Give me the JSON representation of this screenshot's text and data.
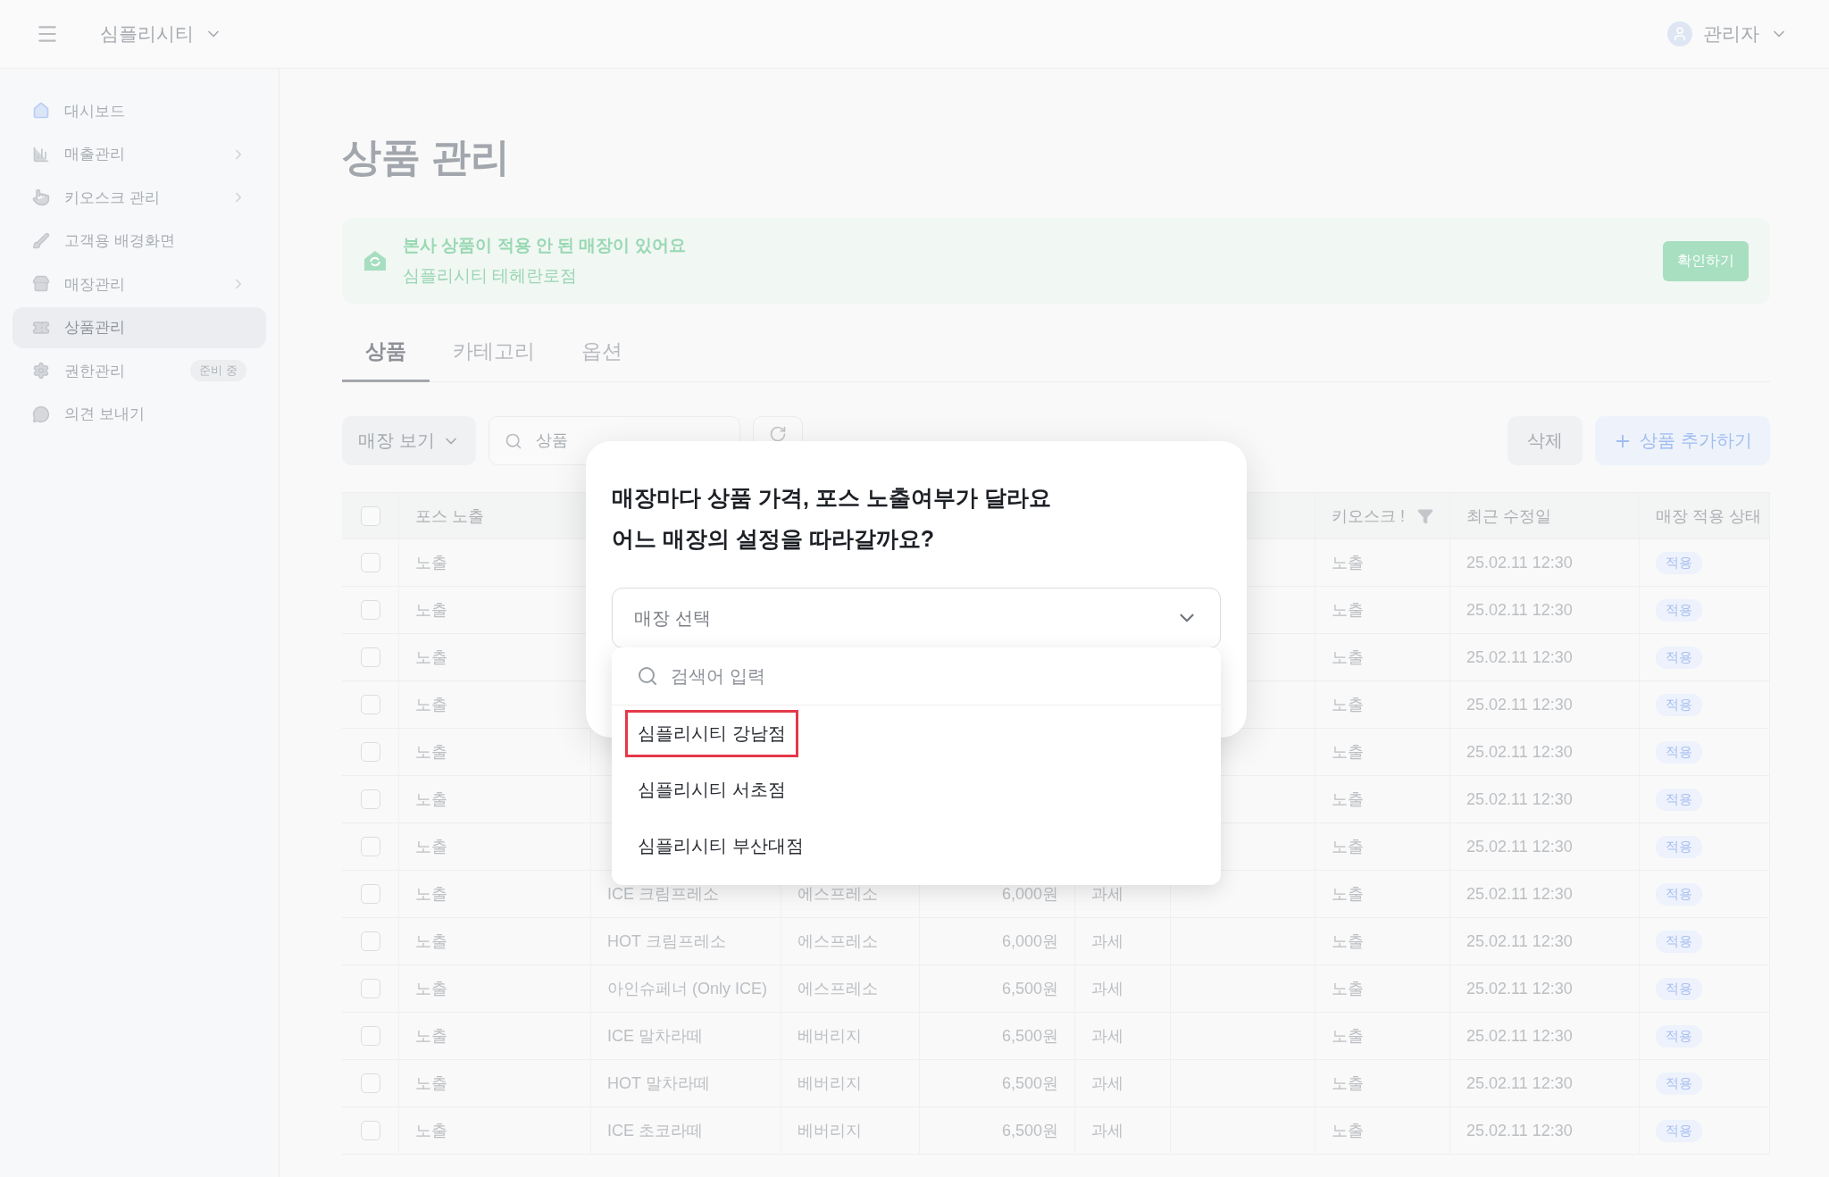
{
  "header": {
    "brand": "심플리시티",
    "user": "관리자"
  },
  "sidebar": {
    "items": [
      {
        "label": "대시보드",
        "selected": false,
        "has_submenu": false
      },
      {
        "label": "매출관리",
        "selected": false,
        "has_submenu": true
      },
      {
        "label": "키오스크 관리",
        "selected": false,
        "has_submenu": true
      },
      {
        "label": "고객용 배경화면",
        "selected": false,
        "has_submenu": false
      },
      {
        "label": "매장관리",
        "selected": false,
        "has_submenu": true
      },
      {
        "label": "상품관리",
        "selected": true,
        "has_submenu": false
      },
      {
        "label": "권한관리",
        "selected": false,
        "has_submenu": false,
        "badge": "준비 중"
      },
      {
        "label": "의견 보내기",
        "selected": false,
        "has_submenu": false
      }
    ]
  },
  "page_title": "상품 관리",
  "banner": {
    "title": "본사 상품이 적용 안 된 매장이 있어요",
    "subtitle": "심플리시티 테헤란로점",
    "button": "확인하기"
  },
  "tabs": [
    {
      "label": "상품",
      "selected": true
    },
    {
      "label": "카테고리",
      "selected": false
    },
    {
      "label": "옵션",
      "selected": false
    }
  ],
  "toolbar": {
    "store_filter": "매장 보기",
    "search_placeholder": "상품",
    "delete": "삭제",
    "add": "상품 추가하기"
  },
  "table": {
    "header": {
      "pos": "포스 노출",
      "kiosk": "키오스크 !",
      "updated": "최근 수정일",
      "status": "매장 적용 상태"
    },
    "rows": [
      {
        "checked": false,
        "pos": "노출",
        "kiosk": "노출",
        "updated": "25.02.11 12:30",
        "status": "적용"
      },
      {
        "checked": false,
        "pos": "노출",
        "kiosk": "노출",
        "updated": "25.02.11 12:30",
        "status": "적용"
      },
      {
        "checked": false,
        "pos": "노출",
        "kiosk": "노출",
        "updated": "25.02.11 12:30",
        "status": "적용"
      },
      {
        "checked": false,
        "pos": "노출",
        "kiosk": "노출",
        "updated": "25.02.11 12:30",
        "status": "적용"
      },
      {
        "checked": false,
        "pos": "노출",
        "kiosk": "노출",
        "updated": "25.02.11 12:30",
        "status": "적용"
      },
      {
        "checked": false,
        "pos": "노출",
        "kiosk": "노출",
        "updated": "25.02.11 12:30",
        "status": "적용"
      },
      {
        "checked": false,
        "pos": "노출",
        "kiosk": "노출",
        "updated": "25.02.11 12:30",
        "status": "적용"
      },
      {
        "checked": false,
        "pos": "노출",
        "name": "ICE 크림프레소",
        "category": "에스프레소",
        "price": "6,000원",
        "tax": "과세",
        "kiosk": "노출",
        "updated": "25.02.11 12:30",
        "status": "적용"
      },
      {
        "checked": false,
        "pos": "노출",
        "name": "HOT 크림프레소",
        "category": "에스프레소",
        "price": "6,000원",
        "tax": "과세",
        "kiosk": "노출",
        "updated": "25.02.11 12:30",
        "status": "적용"
      },
      {
        "checked": false,
        "pos": "노출",
        "name": "아인슈페너 (Only ICE)",
        "category": "에스프레소",
        "price": "6,500원",
        "tax": "과세",
        "kiosk": "노출",
        "updated": "25.02.11 12:30",
        "status": "적용"
      },
      {
        "checked": false,
        "pos": "노출",
        "name": "ICE 말차라떼",
        "category": "베버리지",
        "price": "6,500원",
        "tax": "과세",
        "kiosk": "노출",
        "updated": "25.02.11 12:30",
        "status": "적용"
      },
      {
        "checked": false,
        "pos": "노출",
        "name": "HOT 말차라떼",
        "category": "베버리지",
        "price": "6,500원",
        "tax": "과세",
        "kiosk": "노출",
        "updated": "25.02.11 12:30",
        "status": "적용"
      },
      {
        "checked": false,
        "pos": "노출",
        "name": "ICE 초코라떼",
        "category": "베버리지",
        "price": "6,500원",
        "tax": "과세",
        "kiosk": "노출",
        "updated": "25.02.11 12:30",
        "status": "적용"
      }
    ],
    "header_checked": false
  },
  "modal": {
    "title_lines": [
      "매장마다 상품 가격, 포스 노출여부가 달라요",
      "어느 매장의 설정을 따라갈까요?"
    ],
    "select_placeholder": "매장 선택",
    "search_placeholder": "검색어 입력",
    "options": [
      {
        "label": "심플리시티 강남점",
        "highlighted": true
      },
      {
        "label": "심플리시티 서초점",
        "highlighted": false
      },
      {
        "label": "심플리시티 부산대점",
        "highlighted": false
      }
    ]
  }
}
